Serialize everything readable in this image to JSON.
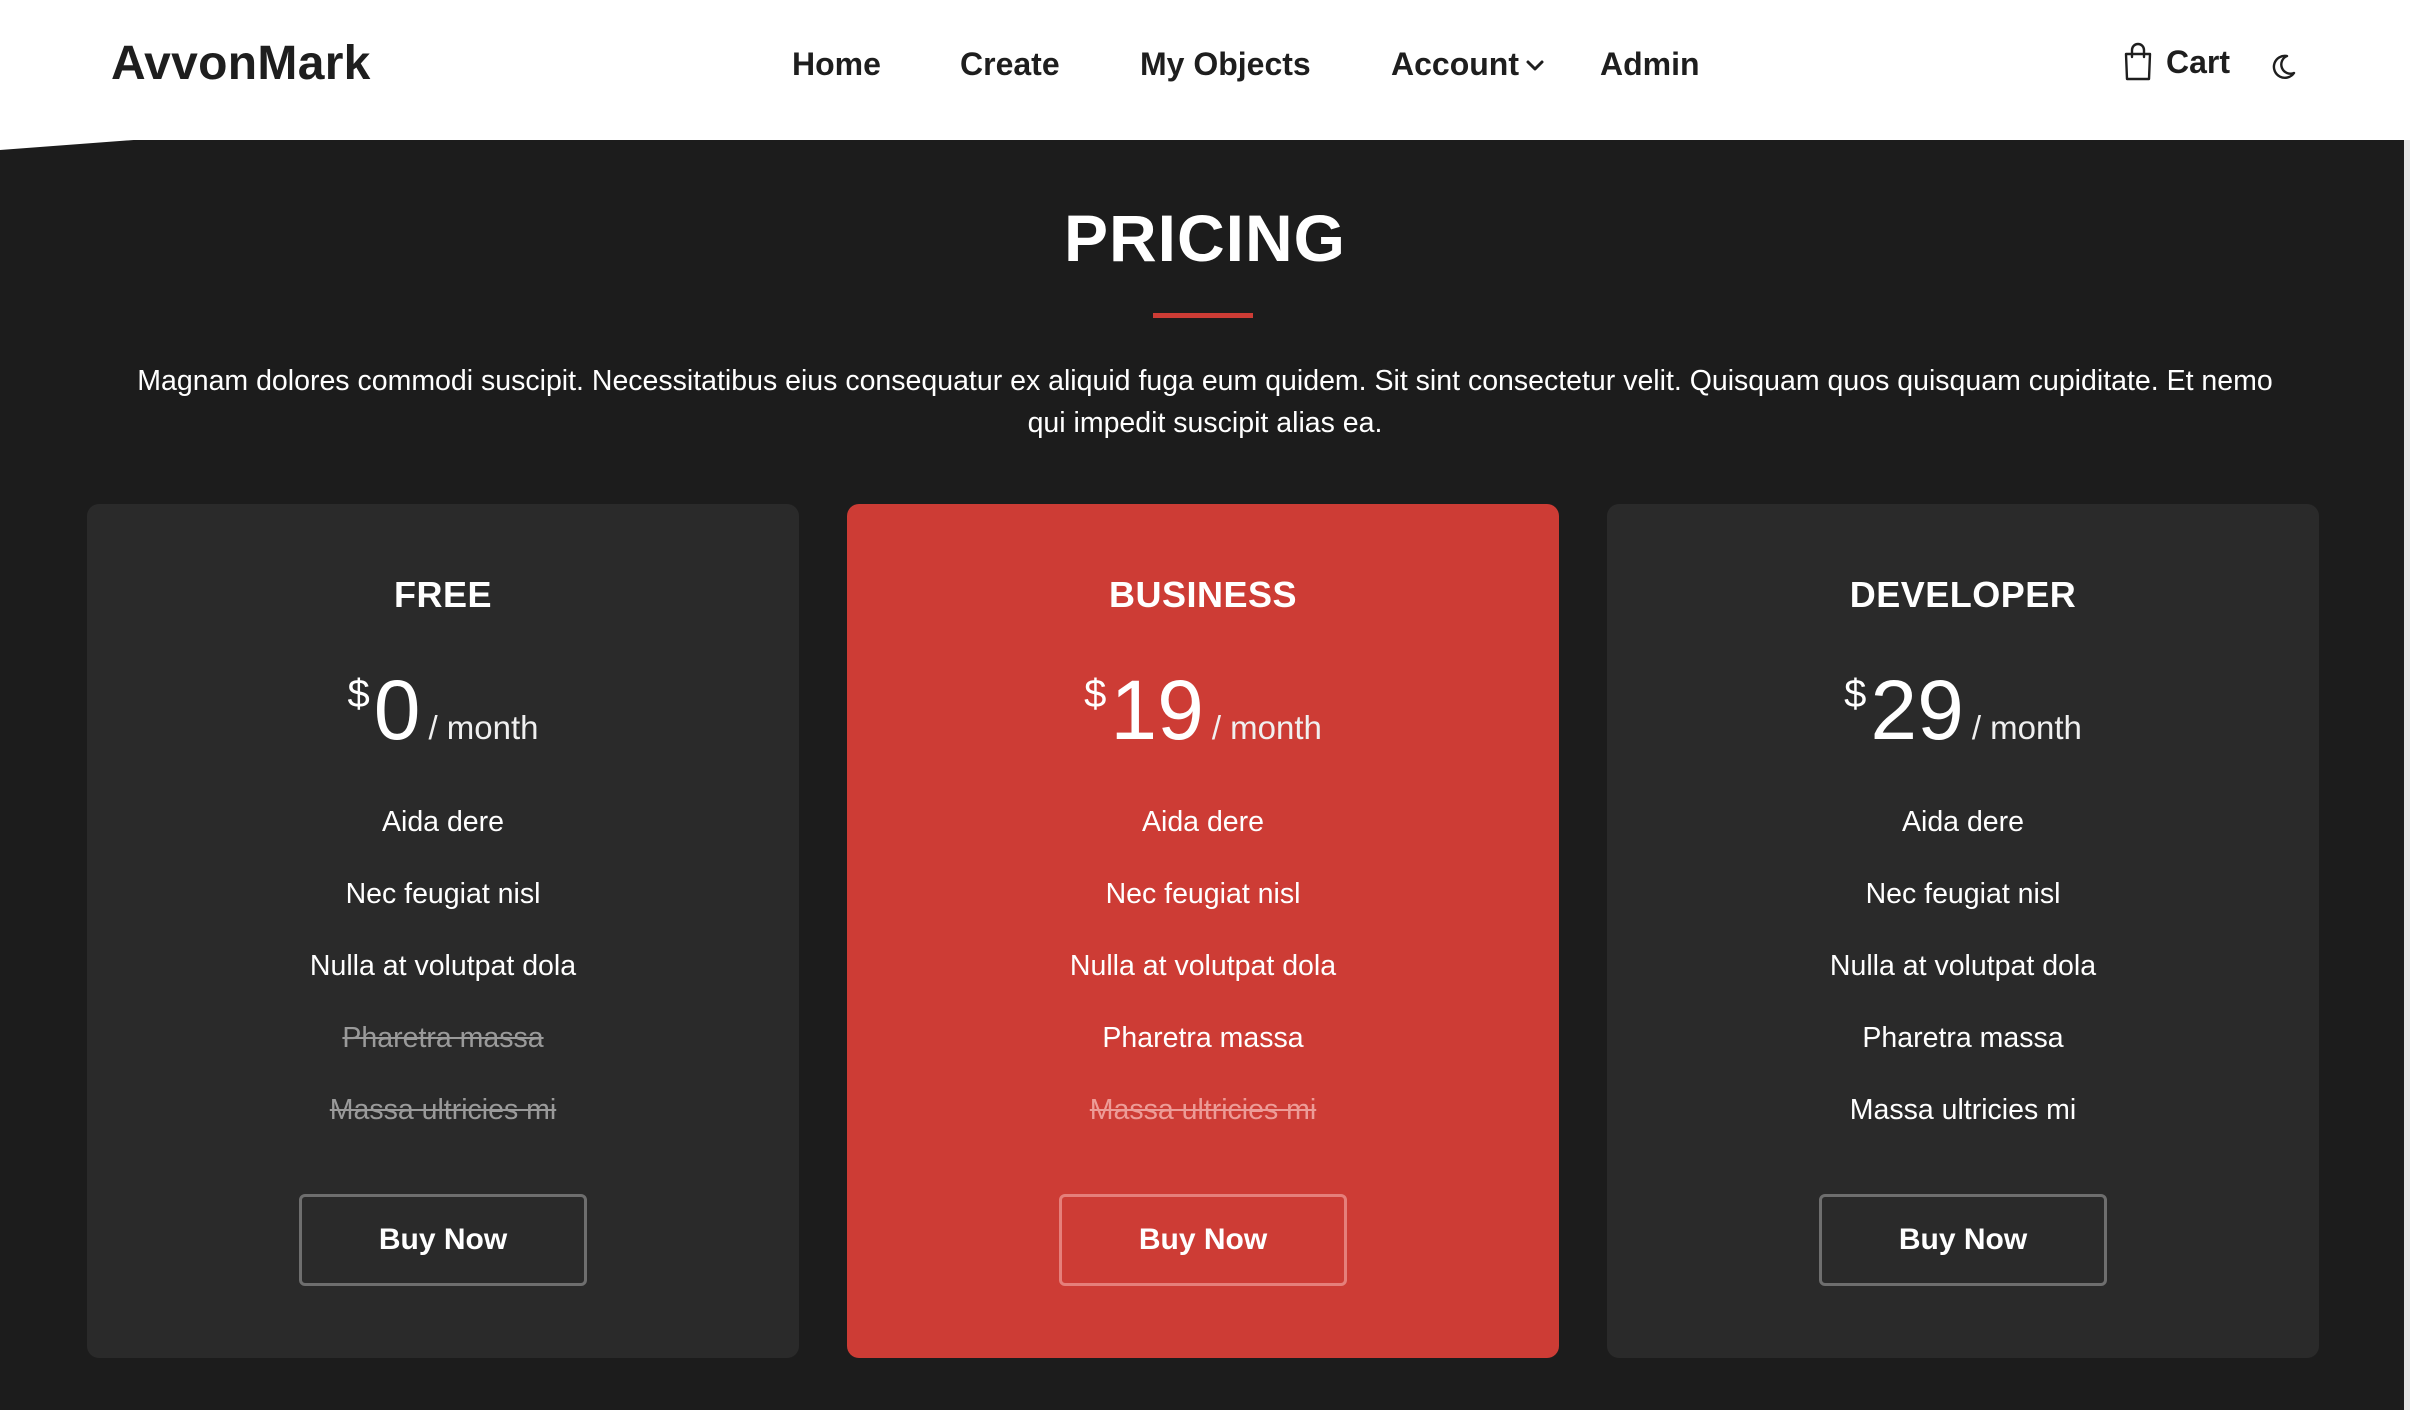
{
  "header": {
    "brand": "AvvonMark",
    "nav": [
      {
        "label": "Home"
      },
      {
        "label": "Create"
      },
      {
        "label": "My Objects"
      },
      {
        "label": "Account",
        "has_dropdown": true
      },
      {
        "label": "Admin"
      }
    ],
    "cart_label": "Cart",
    "icons": {
      "cart": "shopping-bag-icon",
      "theme": "moon-icon",
      "dropdown": "chevron-down-icon"
    }
  },
  "pricing": {
    "title": "PRICING",
    "description": "Magnam dolores commodi suscipit. Necessitatibus eius consequatur ex aliquid fuga eum quidem. Sit sint consectetur velit. Quisquam quos quisquam cupiditate. Et nemo qui impedit suscipit alias ea.",
    "plans": [
      {
        "name": "FREE",
        "currency": "$",
        "amount": "0",
        "period": "/ month",
        "featured": false,
        "features": [
          {
            "text": "Aida dere",
            "available": true
          },
          {
            "text": "Nec feugiat nisl",
            "available": true
          },
          {
            "text": "Nulla at volutpat dola",
            "available": true
          },
          {
            "text": "Pharetra massa",
            "available": false
          },
          {
            "text": "Massa ultricies mi",
            "available": false
          }
        ],
        "button": "Buy Now"
      },
      {
        "name": "BUSINESS",
        "currency": "$",
        "amount": "19",
        "period": "/ month",
        "featured": true,
        "features": [
          {
            "text": "Aida dere",
            "available": true
          },
          {
            "text": "Nec feugiat nisl",
            "available": true
          },
          {
            "text": "Nulla at volutpat dola",
            "available": true
          },
          {
            "text": "Pharetra massa",
            "available": true
          },
          {
            "text": "Massa ultricies mi",
            "available": false
          }
        ],
        "button": "Buy Now"
      },
      {
        "name": "DEVELOPER",
        "currency": "$",
        "amount": "29",
        "period": "/ month",
        "featured": false,
        "features": [
          {
            "text": "Aida dere",
            "available": true
          },
          {
            "text": "Nec feugiat nisl",
            "available": true
          },
          {
            "text": "Nulla at volutpat dola",
            "available": true
          },
          {
            "text": "Pharetra massa",
            "available": true
          },
          {
            "text": "Massa ultricies mi",
            "available": true
          }
        ],
        "button": "Buy Now"
      }
    ]
  },
  "colors": {
    "accent": "#cd3c35",
    "background": "#1c1c1c",
    "card": "#2a2a2a",
    "header": "#ffffff"
  }
}
